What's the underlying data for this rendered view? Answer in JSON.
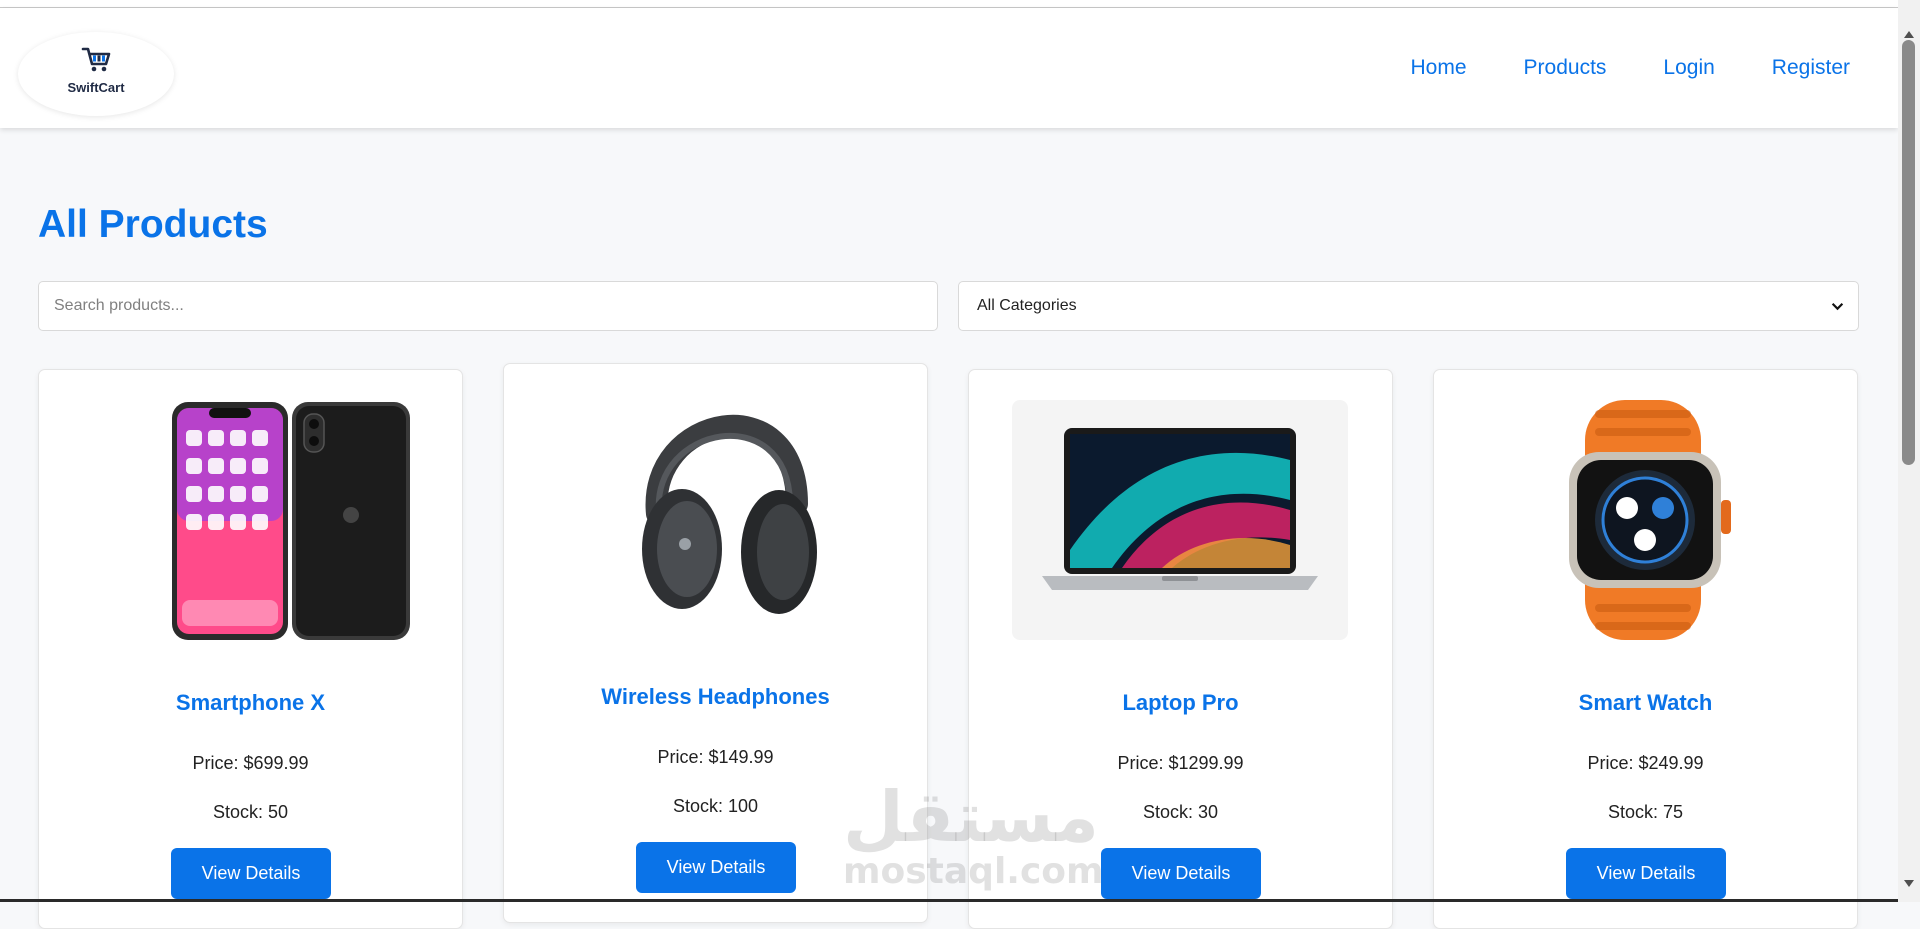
{
  "brand": {
    "name": "SwiftCart",
    "logo_icon": "cart-icon",
    "colors": {
      "accent": "#0a73e8",
      "logo_text": "#1f2a44",
      "button_text": "#ffffff"
    }
  },
  "nav": {
    "items": [
      {
        "label": "Home"
      },
      {
        "label": "Products"
      },
      {
        "label": "Login"
      },
      {
        "label": "Register"
      }
    ]
  },
  "main": {
    "title": "All Products",
    "search": {
      "placeholder": "Search products...",
      "value": ""
    },
    "category_filter": {
      "selected": "All Categories"
    }
  },
  "products": [
    {
      "name": "Smartphone X",
      "price": "Price: $699.99",
      "stock": "Stock: 50",
      "button": "View Details",
      "image_icon": "smartphone-image"
    },
    {
      "name": "Wireless Headphones",
      "price": "Price: $149.99",
      "stock": "Stock: 100",
      "button": "View Details",
      "image_icon": "headphones-image"
    },
    {
      "name": "Laptop Pro",
      "price": "Price: $1299.99",
      "stock": "Stock: 30",
      "button": "View Details",
      "image_icon": "laptop-image"
    },
    {
      "name": "Smart Watch",
      "price": "Price: $249.99",
      "stock": "Stock: 75",
      "button": "View Details",
      "image_icon": "smartwatch-image"
    }
  ],
  "watermark": {
    "arabic": "مستقل",
    "latin": "mostaql.com"
  }
}
